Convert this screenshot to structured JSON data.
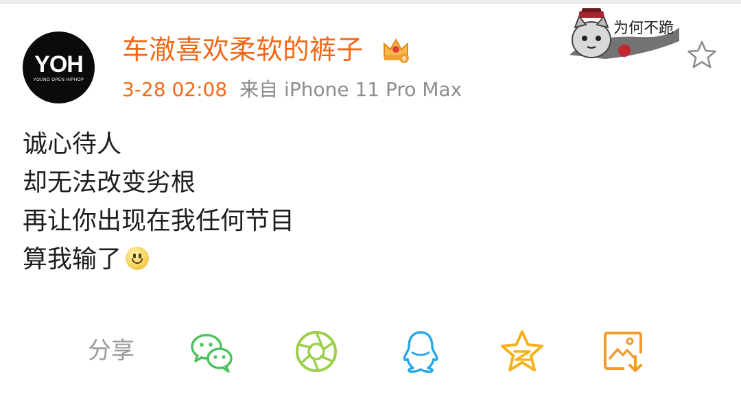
{
  "post": {
    "avatar": {
      "logo": "YOH",
      "tagline": "YOUNG OPEN HIPHOP"
    },
    "username": "车澈喜欢柔软的裤子",
    "vip_level": "6",
    "timestamp": "3-28 02:08",
    "source": "来自 iPhone 11 Pro Max",
    "sticker_text": "为何不跪",
    "content_lines": [
      "诚心待人",
      "却无法改变劣根",
      "再让你出现在我任何节目",
      "算我输了"
    ]
  },
  "share_bar": {
    "label": "分享",
    "icons": [
      "wechat-icon",
      "moments-icon",
      "qq-icon",
      "qzone-icon",
      "save-image-icon"
    ]
  },
  "colors": {
    "username": "#f0691a",
    "meta_gray": "#8d8d8d",
    "wechat_green": "#4fc05f",
    "moments_green": "#9ccf4c",
    "qq_blue": "#2aa7e6",
    "qzone_yellow": "#f5b21a",
    "save_orange": "#f29a2e"
  }
}
